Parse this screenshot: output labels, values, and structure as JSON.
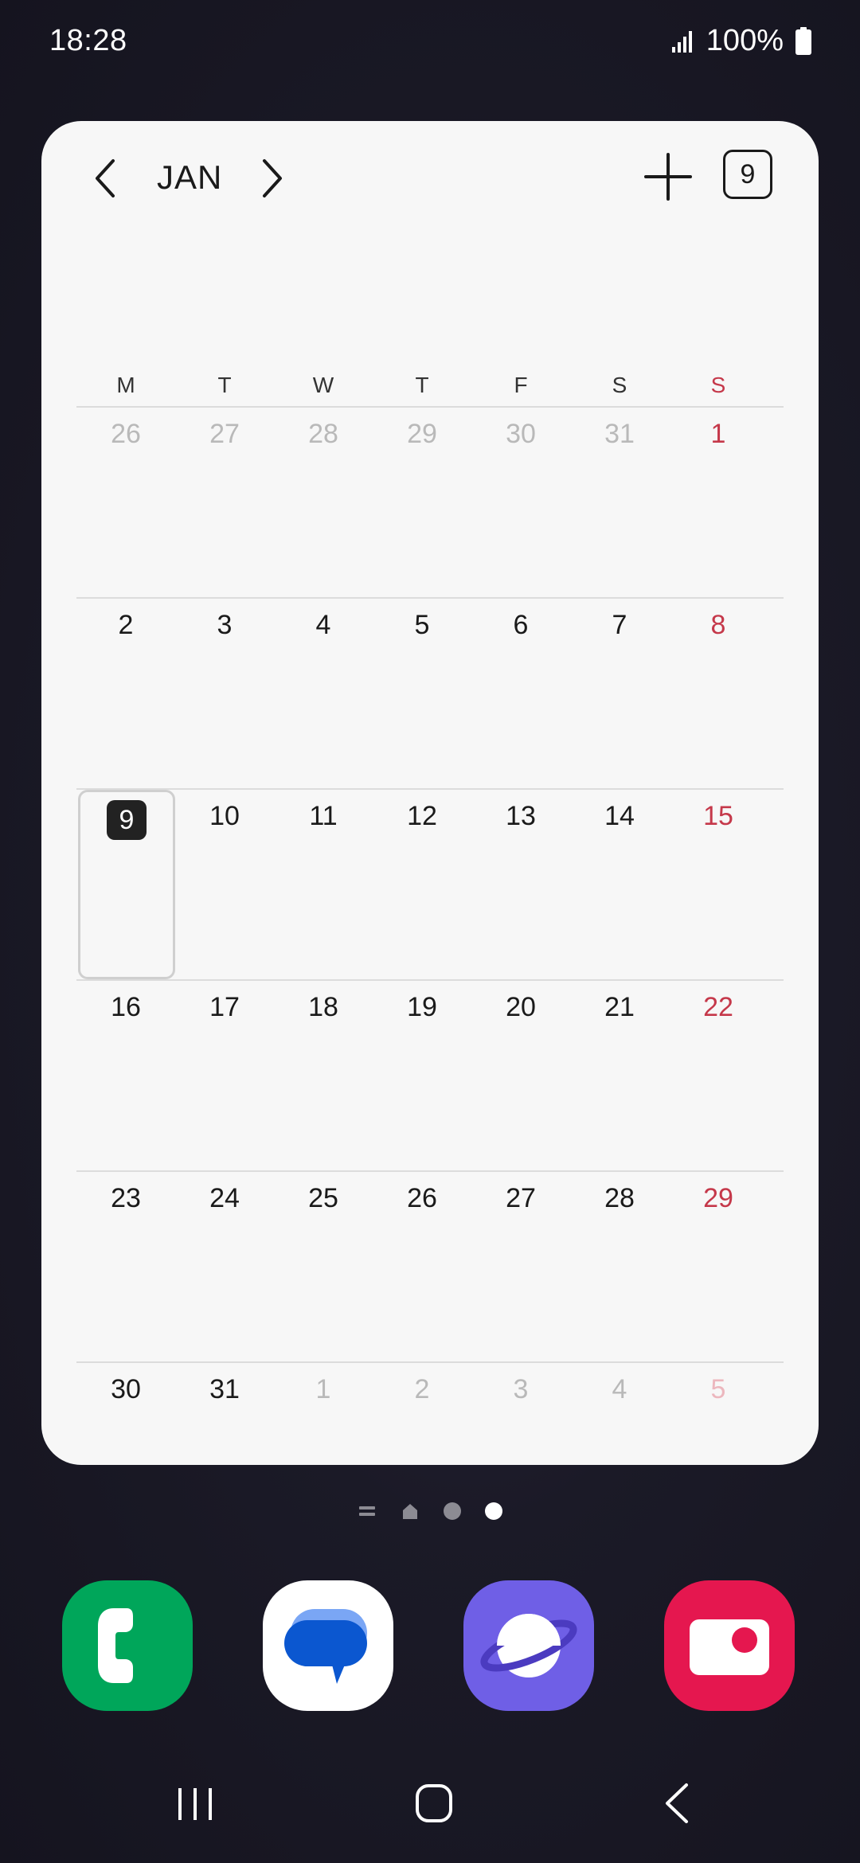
{
  "status_bar": {
    "time": "18:28",
    "battery": "100%"
  },
  "calendar": {
    "month": "JAN",
    "today_button": "9",
    "weekdays": [
      "M",
      "T",
      "W",
      "T",
      "F",
      "S",
      "S"
    ],
    "weeks": [
      [
        {
          "d": "26",
          "o": true
        },
        {
          "d": "27",
          "o": true
        },
        {
          "d": "28",
          "o": true
        },
        {
          "d": "29",
          "o": true
        },
        {
          "d": "30",
          "o": true
        },
        {
          "d": "31",
          "o": true
        },
        {
          "d": "1",
          "o": false
        }
      ],
      [
        {
          "d": "2",
          "o": false
        },
        {
          "d": "3",
          "o": false
        },
        {
          "d": "4",
          "o": false
        },
        {
          "d": "5",
          "o": false
        },
        {
          "d": "6",
          "o": false
        },
        {
          "d": "7",
          "o": false
        },
        {
          "d": "8",
          "o": false
        }
      ],
      [
        {
          "d": "9",
          "o": false,
          "today": true
        },
        {
          "d": "10",
          "o": false
        },
        {
          "d": "11",
          "o": false
        },
        {
          "d": "12",
          "o": false
        },
        {
          "d": "13",
          "o": false
        },
        {
          "d": "14",
          "o": false
        },
        {
          "d": "15",
          "o": false
        }
      ],
      [
        {
          "d": "16",
          "o": false
        },
        {
          "d": "17",
          "o": false
        },
        {
          "d": "18",
          "o": false
        },
        {
          "d": "19",
          "o": false
        },
        {
          "d": "20",
          "o": false
        },
        {
          "d": "21",
          "o": false
        },
        {
          "d": "22",
          "o": false
        }
      ],
      [
        {
          "d": "23",
          "o": false
        },
        {
          "d": "24",
          "o": false
        },
        {
          "d": "25",
          "o": false
        },
        {
          "d": "26",
          "o": false
        },
        {
          "d": "27",
          "o": false
        },
        {
          "d": "28",
          "o": false
        },
        {
          "d": "29",
          "o": false
        }
      ],
      [
        {
          "d": "30",
          "o": false
        },
        {
          "d": "31",
          "o": false
        },
        {
          "d": "1",
          "o": true
        },
        {
          "d": "2",
          "o": true
        },
        {
          "d": "3",
          "o": true
        },
        {
          "d": "4",
          "o": true
        },
        {
          "d": "5",
          "o": true
        }
      ]
    ]
  },
  "colors": {
    "sunday": "#c5384a",
    "phone": "#00a65a",
    "internet": "#6f5fe6",
    "camera": "#e5174f"
  },
  "dock": {
    "apps": [
      "phone-icon",
      "messages-icon",
      "internet-icon",
      "camera-icon"
    ]
  }
}
